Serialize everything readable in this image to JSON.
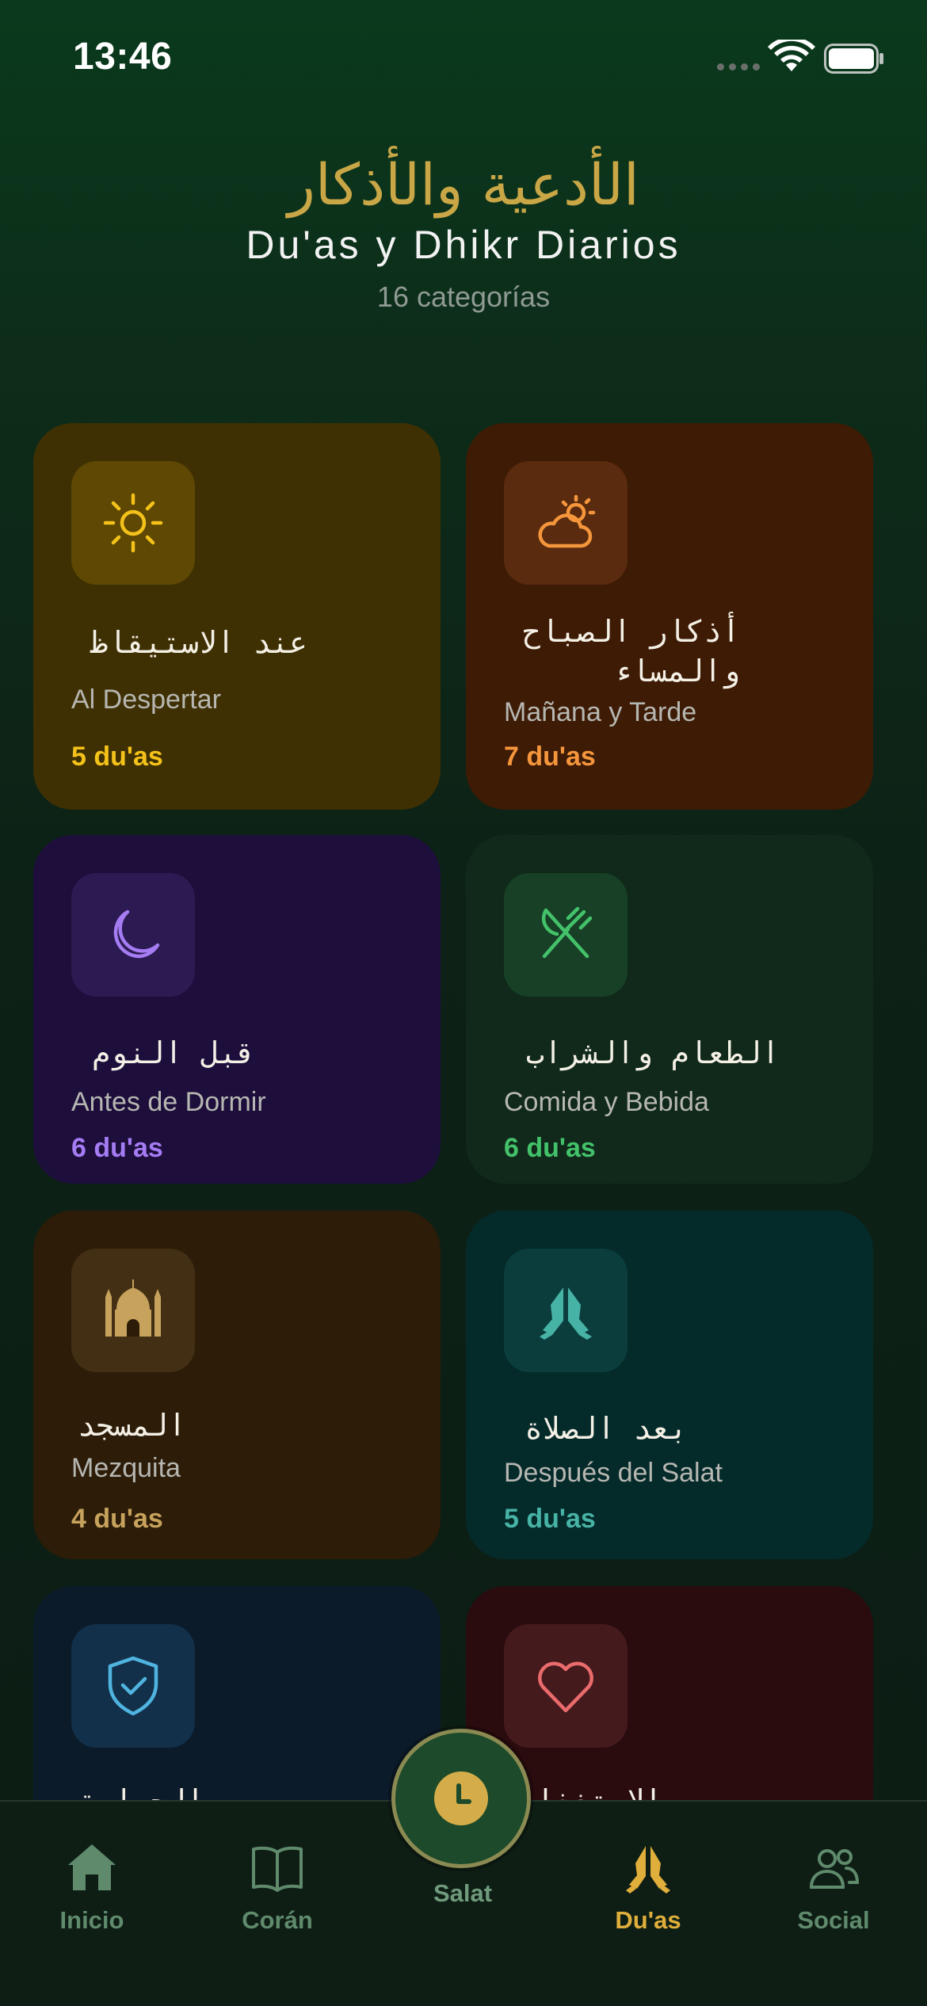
{
  "status_bar": {
    "time": "13:46"
  },
  "header": {
    "arabic_title": "الأدعية والأذكار",
    "title": "Du'as y Dhikr Diarios",
    "subtitle": "16 categorías"
  },
  "colors": {
    "gold": "#c9a646",
    "yellow": "#f4c21a",
    "orange": "#f5963c",
    "purple": "#a57cf3",
    "green": "#43c26a",
    "tan": "#c7a25d",
    "teal": "#47b3a6",
    "sky": "#4fb4df",
    "rose": "#ea6b6b"
  },
  "categories": [
    {
      "arabic": "عند الاستيقاظ",
      "name": "Al Despertar",
      "count": "5 du'as",
      "icon": "sun-icon"
    },
    {
      "arabic": "أذكار الصباح والمساء",
      "name": "Mañana y Tarde",
      "count": "7 du'as",
      "icon": "cloud-sun-icon"
    },
    {
      "arabic": "قبل النوم",
      "name": "Antes de Dormir",
      "count": "6 du'as",
      "icon": "moon-icon"
    },
    {
      "arabic": "الطعام والشراب",
      "name": "Comida y Bebida",
      "count": "6 du'as",
      "icon": "utensils-icon"
    },
    {
      "arabic": "المسجد",
      "name": "Mezquita",
      "count": "4 du'as",
      "icon": "mosque-icon"
    },
    {
      "arabic": "بعد الصلاة",
      "name": "Después del Salat",
      "count": "5 du'as",
      "icon": "praying-hands-icon"
    },
    {
      "arabic": "الحماية",
      "name": "",
      "count": "",
      "icon": "shield-check-icon"
    },
    {
      "arabic": "الاستغفار",
      "name": "",
      "count": "",
      "icon": "heart-icon"
    }
  ],
  "tab_bar": {
    "tabs": [
      {
        "label": "Inicio",
        "icon": "home-icon"
      },
      {
        "label": "Corán",
        "icon": "book-icon"
      },
      {
        "label": "Salat",
        "icon": "clock-icon"
      },
      {
        "label": "Du'as",
        "icon": "praying-hands-icon",
        "active": true
      },
      {
        "label": "Social",
        "icon": "people-icon"
      }
    ]
  }
}
